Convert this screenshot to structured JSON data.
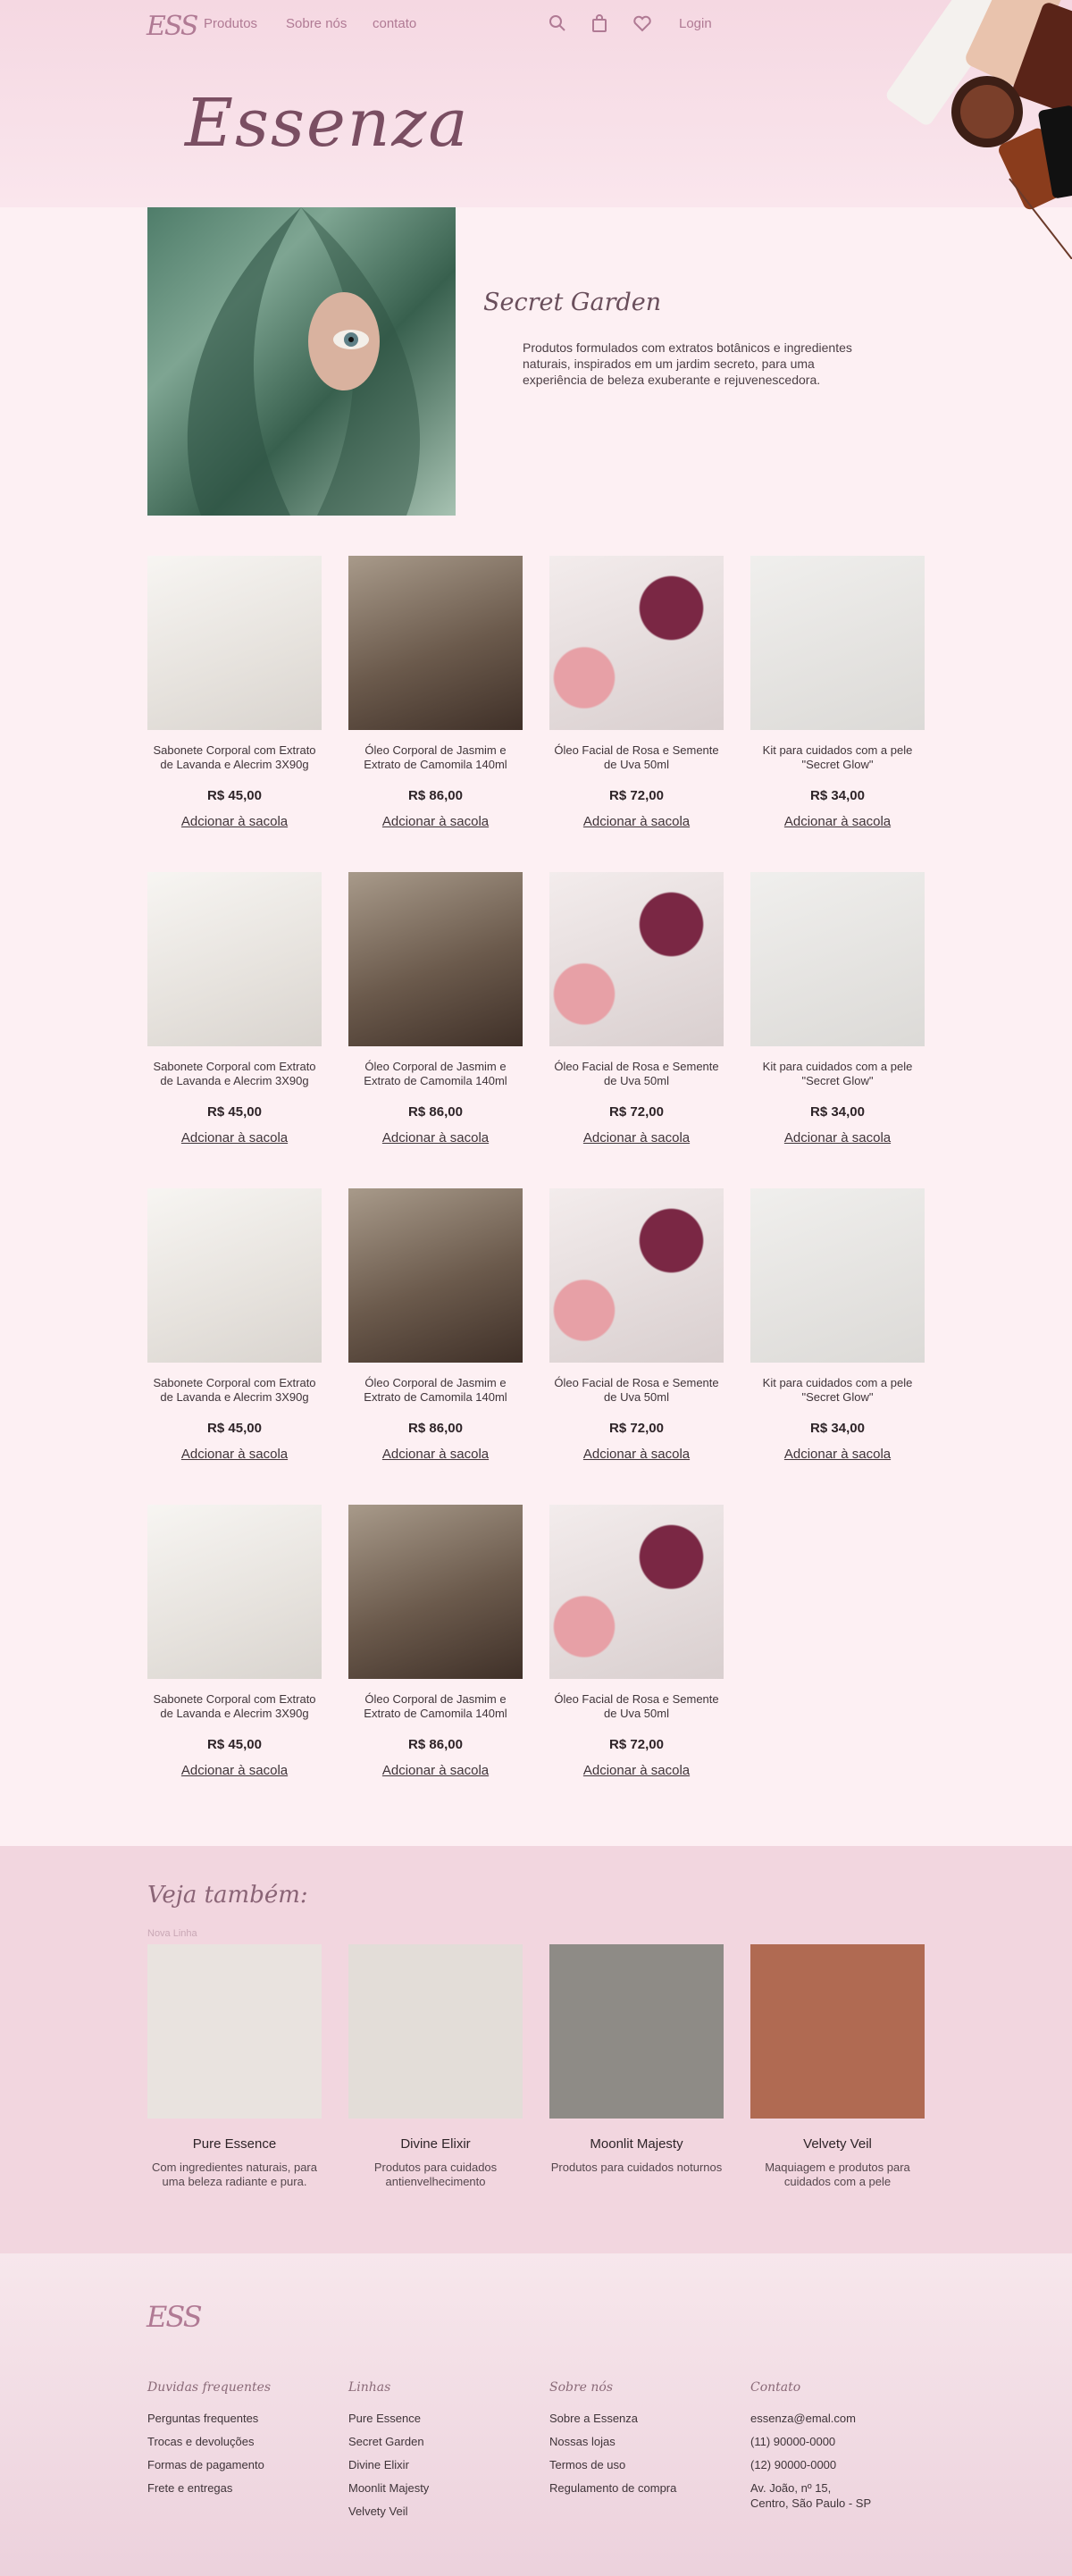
{
  "header": {
    "logo_text": "ESS",
    "nav": [
      "Produtos",
      "Sobre nós",
      "contato"
    ],
    "login": "Login",
    "icons": [
      "search-icon",
      "bag-icon",
      "heart-icon"
    ],
    "brand": "Essenza"
  },
  "hero": {
    "title": "Secret Garden",
    "description": "Produtos formulados com extratos botânicos e ingredientes naturais, inspirados em um jardim secreto, para uma experiência de beleza exuberante e rejuvenescedora."
  },
  "products": [
    {
      "name": "Sabonete Corporal com Extrato de Lavanda e Alecrim 3X90g",
      "price": "R$ 45,00",
      "cta": "Adcionar à sacola",
      "img": "soap"
    },
    {
      "name": "Óleo Corporal de Jasmim e Extrato de Camomila 140ml",
      "price": "R$ 86,00",
      "cta": "Adcionar à sacola",
      "img": "oil"
    },
    {
      "name": "Óleo Facial de Rosa e Semente de Uva 50ml",
      "price": "R$ 72,00",
      "cta": "Adcionar à sacola",
      "img": "face"
    },
    {
      "name": "Kit para cuidados com a pele \"Secret Glow\"",
      "price": "R$ 34,00",
      "cta": "Adcionar à sacola",
      "img": "kit"
    },
    {
      "name": "Sabonete Corporal com Extrato de Lavanda e Alecrim 3X90g",
      "price": "R$ 45,00",
      "cta": "Adcionar à sacola",
      "img": "soap"
    },
    {
      "name": "Óleo Corporal de Jasmim e Extrato de Camomila 140ml",
      "price": "R$ 86,00",
      "cta": "Adcionar à sacola",
      "img": "oil"
    },
    {
      "name": "Óleo Facial de Rosa e Semente de Uva 50ml",
      "price": "R$ 72,00",
      "cta": "Adcionar à sacola",
      "img": "face"
    },
    {
      "name": "Kit para cuidados com a pele \"Secret Glow\"",
      "price": "R$ 34,00",
      "cta": "Adcionar à sacola",
      "img": "kit"
    },
    {
      "name": "Sabonete Corporal com Extrato de Lavanda e Alecrim 3X90g",
      "price": "R$ 45,00",
      "cta": "Adcionar à sacola",
      "img": "soap"
    },
    {
      "name": "Óleo Corporal de Jasmim e Extrato de Camomila 140ml",
      "price": "R$ 86,00",
      "cta": "Adcionar à sacola",
      "img": "oil"
    },
    {
      "name": "Óleo Facial de Rosa e Semente de Uva 50ml",
      "price": "R$ 72,00",
      "cta": "Adcionar à sacola",
      "img": "face"
    },
    {
      "name": "Kit para cuidados com a pele \"Secret Glow\"",
      "price": "R$ 34,00",
      "cta": "Adcionar à sacola",
      "img": "kit"
    },
    {
      "name": "Sabonete Corporal com Extrato de Lavanda e Alecrim 3X90g",
      "price": "R$ 45,00",
      "cta": "Adcionar à sacola",
      "img": "soap"
    },
    {
      "name": "Óleo Corporal de Jasmim e Extrato de Camomila 140ml",
      "price": "R$ 86,00",
      "cta": "Adcionar à sacola",
      "img": "oil"
    },
    {
      "name": "Óleo Facial de Rosa e Semente de Uva 50ml",
      "price": "R$ 72,00",
      "cta": "Adcionar à sacola",
      "img": "face"
    }
  ],
  "see_also": {
    "title": "Veja também:",
    "tag": "Nova Linha",
    "lines": [
      {
        "name": "Pure Essence",
        "desc": "Com ingredientes naturais, para uma beleza radiante e pura.",
        "color": "#e9e3df"
      },
      {
        "name": "Divine Elixir",
        "desc": "Produtos para cuidados antienvelhecimento",
        "color": "#e3ddd8"
      },
      {
        "name": "Moonlit Majesty",
        "desc": "Produtos para cuidados noturnos",
        "color": "#8e8b86"
      },
      {
        "name": "Velvety Veil",
        "desc": "Maquiagem e produtos para cuidados com a pele",
        "color": "#b06a52"
      }
    ]
  },
  "footer": {
    "logo_text": "ESS",
    "columns": [
      {
        "heading": "Duvidas frequentes",
        "items": [
          "Perguntas frequentes",
          "Trocas e devoluções",
          "Formas de pagamento",
          "Frete e entregas"
        ]
      },
      {
        "heading": "Linhas",
        "items": [
          "Pure Essence",
          "Secret Garden",
          "Divine Elixir",
          "Moonlit  Majesty",
          "Velvety Veil"
        ]
      },
      {
        "heading": "Sobre nós",
        "items": [
          "Sobre a Essenza",
          "Nossas lojas",
          "Termos de uso",
          "Regulamento de compra"
        ]
      },
      {
        "heading": "Contato",
        "items": [
          "essenza@emal.com",
          "(11) 90000-0000",
          "(12) 90000-0000",
          "Av. João, nº 15,\nCentro, São Paulo - SP"
        ]
      }
    ]
  },
  "colors": {
    "accent": "#b07a94",
    "brand": "#7a4e62",
    "background": "#fdf0f3",
    "band": "#f2d6df"
  }
}
